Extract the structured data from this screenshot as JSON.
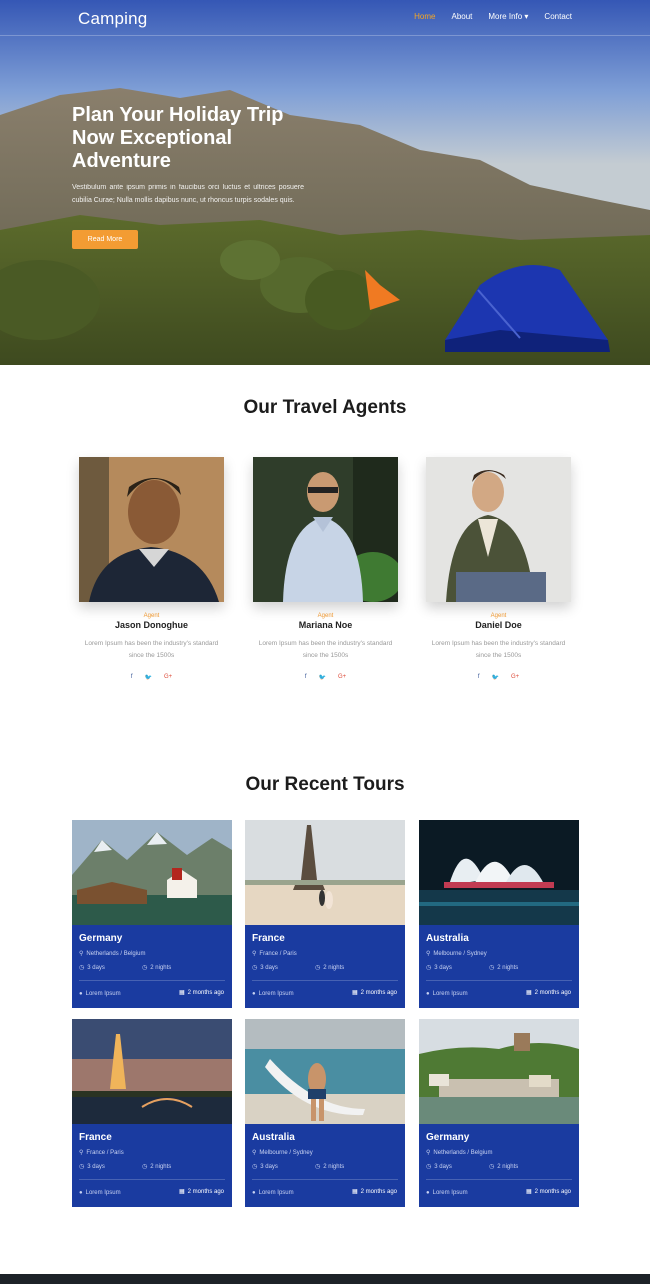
{
  "nav": {
    "brand": "Camping",
    "items": [
      "Home",
      "About",
      "More Info ▾",
      "Contact"
    ]
  },
  "hero": {
    "title": "Plan Your Holiday Trip Now Exceptional Adventure",
    "text": "Vestibulum ante ipsum primis in faucibus orci luctus et ultrices posuere cubilia Curae; Nulla mollis dapibus nunc, ut rhoncus turpis sodales quis.",
    "button": "Read More"
  },
  "agents": {
    "title": "Our Travel Agents",
    "list": [
      {
        "role": "Agent",
        "name": "Jason Donoghue",
        "bio": "Lorem Ipsum has been the industry's standard since the 1500s"
      },
      {
        "role": "Agent",
        "name": "Mariana Noe",
        "bio": "Lorem Ipsum has been the industry's standard since the 1500s"
      },
      {
        "role": "Agent",
        "name": "Daniel Doe",
        "bio": "Lorem Ipsum has been the industry's standard since the 1500s"
      }
    ],
    "social_icons": [
      "facebook-icon",
      "twitter-icon",
      "google-plus-icon"
    ]
  },
  "tours": {
    "title": "Our Recent Tours",
    "list": [
      {
        "country": "Germany",
        "location": "Netherlands / Belgium",
        "days": "3 days",
        "nights": "2 nights",
        "author": "Lorem Ipsum",
        "ago": "2 months ago"
      },
      {
        "country": "France",
        "location": "France / Paris",
        "days": "3 days",
        "nights": "2 nights",
        "author": "Lorem Ipsum",
        "ago": "2 months ago"
      },
      {
        "country": "Australia",
        "location": "Melbourne / Sydney",
        "days": "3 days",
        "nights": "2 nights",
        "author": "Lorem Ipsum",
        "ago": "2 months ago"
      },
      {
        "country": "France",
        "location": "France / Paris",
        "days": "3 days",
        "nights": "2 nights",
        "author": "Lorem Ipsum",
        "ago": "2 months ago"
      },
      {
        "country": "Australia",
        "location": "Melbourne / Sydney",
        "days": "3 days",
        "nights": "2 nights",
        "author": "Lorem Ipsum",
        "ago": "2 months ago"
      },
      {
        "country": "Germany",
        "location": "Netherlands / Belgium",
        "days": "3 days",
        "nights": "2 nights",
        "author": "Lorem Ipsum",
        "ago": "2 months ago"
      }
    ]
  },
  "colors": {
    "accent": "#f39c33",
    "tour_card": "#1a3ba0",
    "footer": "#1d2228"
  }
}
